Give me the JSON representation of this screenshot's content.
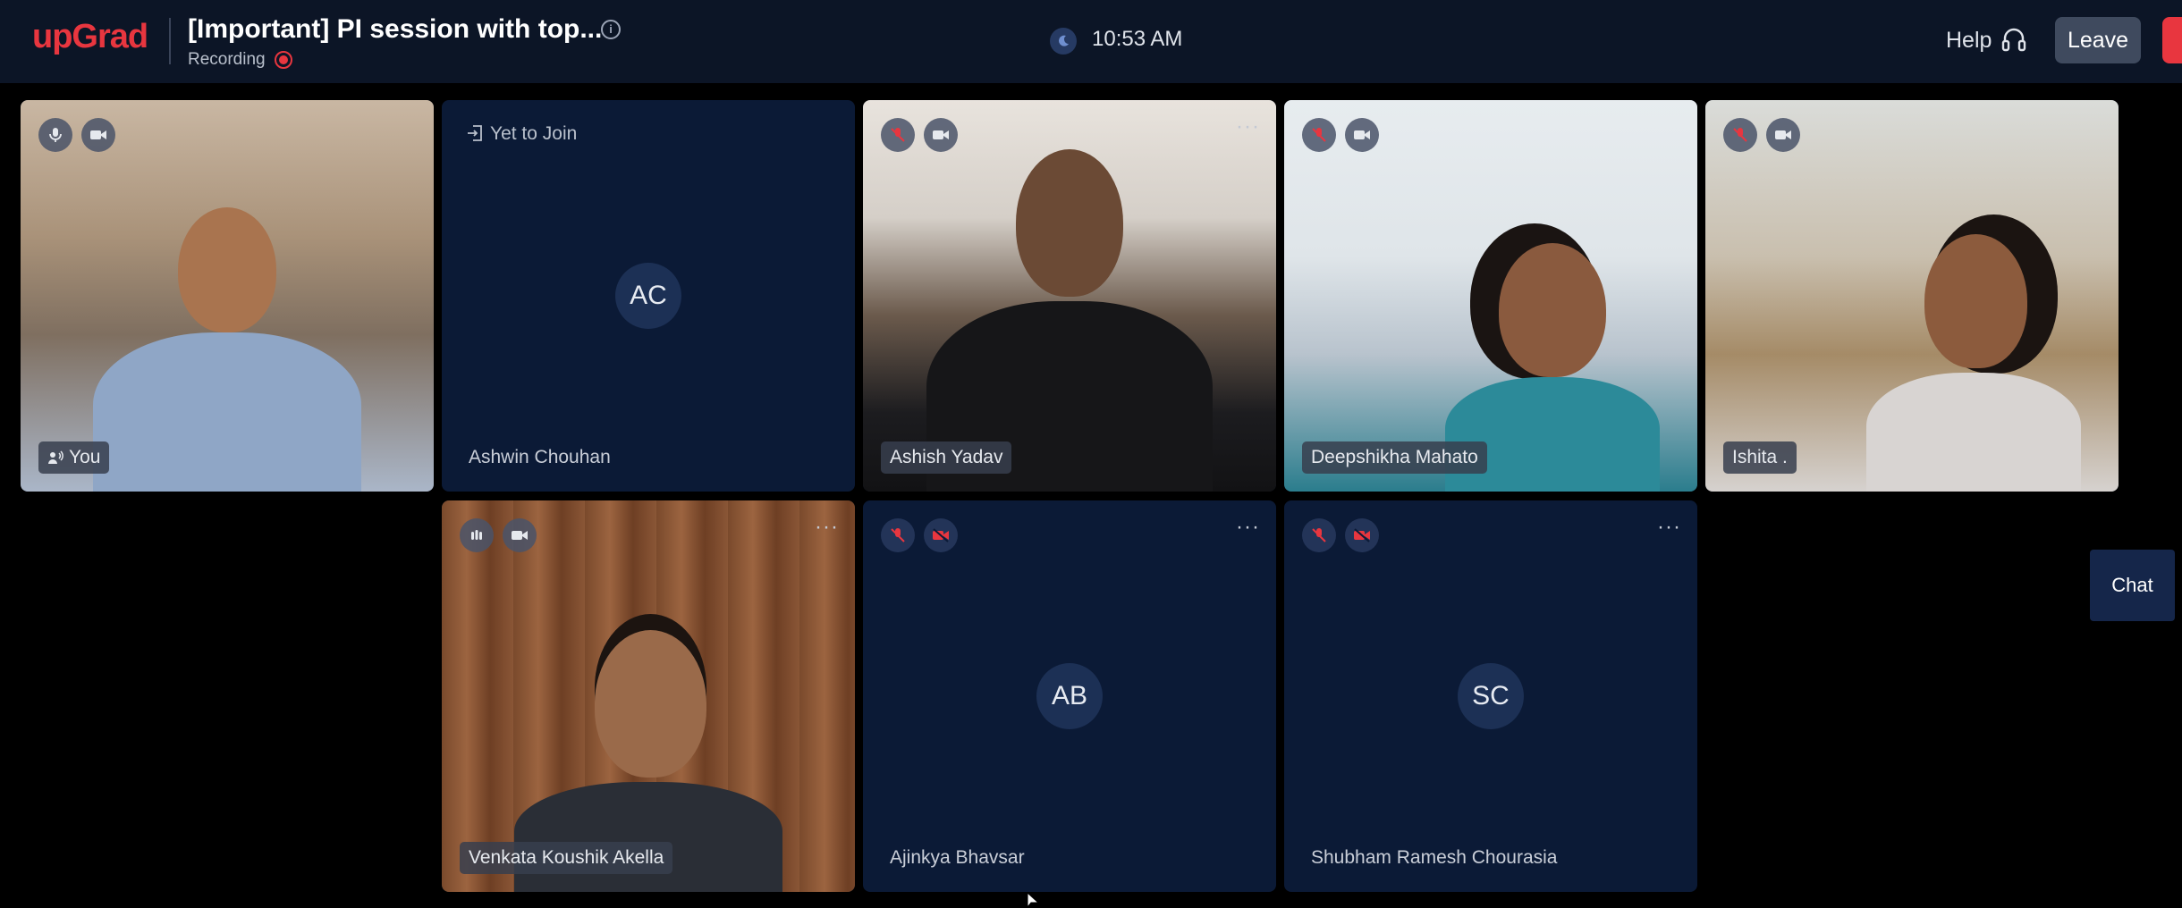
{
  "app": {
    "logo": "upGrad"
  },
  "header": {
    "title": "[Important] PI session with top...",
    "recording_label": "Recording",
    "time": "10:53 AM",
    "help_label": "Help",
    "leave_label": "Leave"
  },
  "tiles": [
    {
      "name": "You",
      "state": "video",
      "mic": "on",
      "camera": "on"
    },
    {
      "name": "Ashwin Chouhan",
      "state": "Yet to Join",
      "initials": "AC"
    },
    {
      "name": "Ashish Yadav",
      "state": "video",
      "mic": "muted",
      "camera": "on"
    },
    {
      "name": "Deepshikha Mahato",
      "state": "video",
      "mic": "muted",
      "camera": "on"
    },
    {
      "name": "Ishita .",
      "state": "video",
      "mic": "muted",
      "camera": "on"
    },
    {
      "name": "Venkata Koushik Akella",
      "state": "video",
      "mic": "speaking",
      "camera": "on"
    },
    {
      "name": "Ajinkya Bhavsar",
      "state": "camera-off",
      "initials": "AB",
      "mic": "muted",
      "camera": "off"
    },
    {
      "name": "Shubham Ramesh Chourasia",
      "state": "camera-off",
      "initials": "SC",
      "mic": "muted",
      "camera": "off"
    }
  ],
  "chat": {
    "label": "Chat"
  },
  "colors": {
    "brand": "#e8363f",
    "header_bg": "#0c1526",
    "tile_bg": "#0b1a36",
    "leave_bg": "#3f4a5e"
  },
  "icons": [
    "info-icon",
    "record-icon",
    "clock-icon",
    "headset-icon",
    "mic-icon",
    "mic-off-icon",
    "camera-icon",
    "camera-off-icon",
    "speaking-icon",
    "enter-icon",
    "more-options-icon"
  ]
}
